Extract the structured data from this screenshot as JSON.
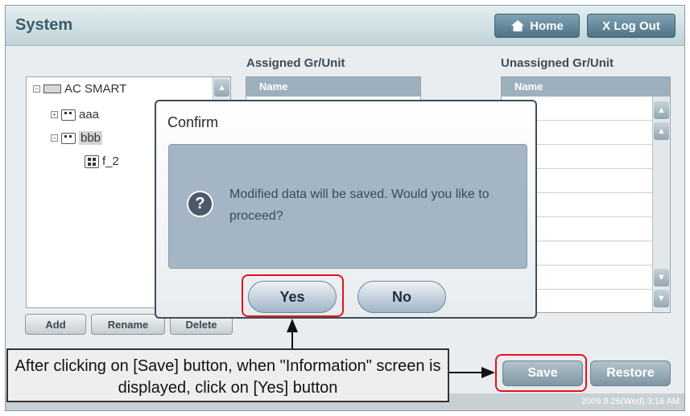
{
  "header": {
    "title": "System",
    "home_label": "Home",
    "logout_label": "X Log Out"
  },
  "tree": {
    "items": [
      {
        "label": "AC SMART"
      },
      {
        "label": "aaa"
      },
      {
        "label": "bbb"
      },
      {
        "label": "f_2"
      }
    ],
    "buttons": {
      "add": "Add",
      "rename": "Rename",
      "delete": "Delete"
    }
  },
  "assigned": {
    "title": "Assigned Gr/Unit",
    "column": "Name"
  },
  "unassigned": {
    "title": "Unassigned Gr/Unit",
    "column": "Name"
  },
  "actions": {
    "save": "Save",
    "restore": "Restore"
  },
  "status": {
    "datetime": "2009.8.26(Wed) 3:16 AM"
  },
  "dialog": {
    "title": "Confirm",
    "message": "Modified data will be saved.  Would you like to proceed?",
    "yes": "Yes",
    "no": "No",
    "icon": "question-icon"
  },
  "annotation": {
    "text": "After clicking on [Save] button, when \"Information\" screen is displayed, click on [Yes] button"
  },
  "colors": {
    "highlight": "#e5121b"
  }
}
